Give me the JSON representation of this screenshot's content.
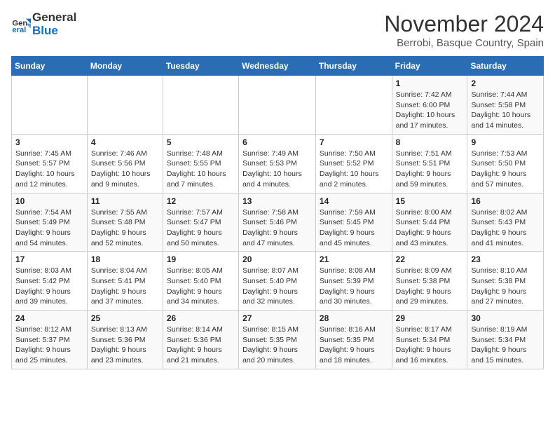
{
  "logo": {
    "line1": "General",
    "line2": "Blue"
  },
  "title": "November 2024",
  "subtitle": "Berrobi, Basque Country, Spain",
  "days_header": [
    "Sunday",
    "Monday",
    "Tuesday",
    "Wednesday",
    "Thursday",
    "Friday",
    "Saturday"
  ],
  "weeks": [
    [
      {
        "num": "",
        "info": ""
      },
      {
        "num": "",
        "info": ""
      },
      {
        "num": "",
        "info": ""
      },
      {
        "num": "",
        "info": ""
      },
      {
        "num": "",
        "info": ""
      },
      {
        "num": "1",
        "info": "Sunrise: 7:42 AM\nSunset: 6:00 PM\nDaylight: 10 hours and 17 minutes."
      },
      {
        "num": "2",
        "info": "Sunrise: 7:44 AM\nSunset: 5:58 PM\nDaylight: 10 hours and 14 minutes."
      }
    ],
    [
      {
        "num": "3",
        "info": "Sunrise: 7:45 AM\nSunset: 5:57 PM\nDaylight: 10 hours and 12 minutes."
      },
      {
        "num": "4",
        "info": "Sunrise: 7:46 AM\nSunset: 5:56 PM\nDaylight: 10 hours and 9 minutes."
      },
      {
        "num": "5",
        "info": "Sunrise: 7:48 AM\nSunset: 5:55 PM\nDaylight: 10 hours and 7 minutes."
      },
      {
        "num": "6",
        "info": "Sunrise: 7:49 AM\nSunset: 5:53 PM\nDaylight: 10 hours and 4 minutes."
      },
      {
        "num": "7",
        "info": "Sunrise: 7:50 AM\nSunset: 5:52 PM\nDaylight: 10 hours and 2 minutes."
      },
      {
        "num": "8",
        "info": "Sunrise: 7:51 AM\nSunset: 5:51 PM\nDaylight: 9 hours and 59 minutes."
      },
      {
        "num": "9",
        "info": "Sunrise: 7:53 AM\nSunset: 5:50 PM\nDaylight: 9 hours and 57 minutes."
      }
    ],
    [
      {
        "num": "10",
        "info": "Sunrise: 7:54 AM\nSunset: 5:49 PM\nDaylight: 9 hours and 54 minutes."
      },
      {
        "num": "11",
        "info": "Sunrise: 7:55 AM\nSunset: 5:48 PM\nDaylight: 9 hours and 52 minutes."
      },
      {
        "num": "12",
        "info": "Sunrise: 7:57 AM\nSunset: 5:47 PM\nDaylight: 9 hours and 50 minutes."
      },
      {
        "num": "13",
        "info": "Sunrise: 7:58 AM\nSunset: 5:46 PM\nDaylight: 9 hours and 47 minutes."
      },
      {
        "num": "14",
        "info": "Sunrise: 7:59 AM\nSunset: 5:45 PM\nDaylight: 9 hours and 45 minutes."
      },
      {
        "num": "15",
        "info": "Sunrise: 8:00 AM\nSunset: 5:44 PM\nDaylight: 9 hours and 43 minutes."
      },
      {
        "num": "16",
        "info": "Sunrise: 8:02 AM\nSunset: 5:43 PM\nDaylight: 9 hours and 41 minutes."
      }
    ],
    [
      {
        "num": "17",
        "info": "Sunrise: 8:03 AM\nSunset: 5:42 PM\nDaylight: 9 hours and 39 minutes."
      },
      {
        "num": "18",
        "info": "Sunrise: 8:04 AM\nSunset: 5:41 PM\nDaylight: 9 hours and 37 minutes."
      },
      {
        "num": "19",
        "info": "Sunrise: 8:05 AM\nSunset: 5:40 PM\nDaylight: 9 hours and 34 minutes."
      },
      {
        "num": "20",
        "info": "Sunrise: 8:07 AM\nSunset: 5:40 PM\nDaylight: 9 hours and 32 minutes."
      },
      {
        "num": "21",
        "info": "Sunrise: 8:08 AM\nSunset: 5:39 PM\nDaylight: 9 hours and 30 minutes."
      },
      {
        "num": "22",
        "info": "Sunrise: 8:09 AM\nSunset: 5:38 PM\nDaylight: 9 hours and 29 minutes."
      },
      {
        "num": "23",
        "info": "Sunrise: 8:10 AM\nSunset: 5:38 PM\nDaylight: 9 hours and 27 minutes."
      }
    ],
    [
      {
        "num": "24",
        "info": "Sunrise: 8:12 AM\nSunset: 5:37 PM\nDaylight: 9 hours and 25 minutes."
      },
      {
        "num": "25",
        "info": "Sunrise: 8:13 AM\nSunset: 5:36 PM\nDaylight: 9 hours and 23 minutes."
      },
      {
        "num": "26",
        "info": "Sunrise: 8:14 AM\nSunset: 5:36 PM\nDaylight: 9 hours and 21 minutes."
      },
      {
        "num": "27",
        "info": "Sunrise: 8:15 AM\nSunset: 5:35 PM\nDaylight: 9 hours and 20 minutes."
      },
      {
        "num": "28",
        "info": "Sunrise: 8:16 AM\nSunset: 5:35 PM\nDaylight: 9 hours and 18 minutes."
      },
      {
        "num": "29",
        "info": "Sunrise: 8:17 AM\nSunset: 5:34 PM\nDaylight: 9 hours and 16 minutes."
      },
      {
        "num": "30",
        "info": "Sunrise: 8:19 AM\nSunset: 5:34 PM\nDaylight: 9 hours and 15 minutes."
      }
    ]
  ]
}
